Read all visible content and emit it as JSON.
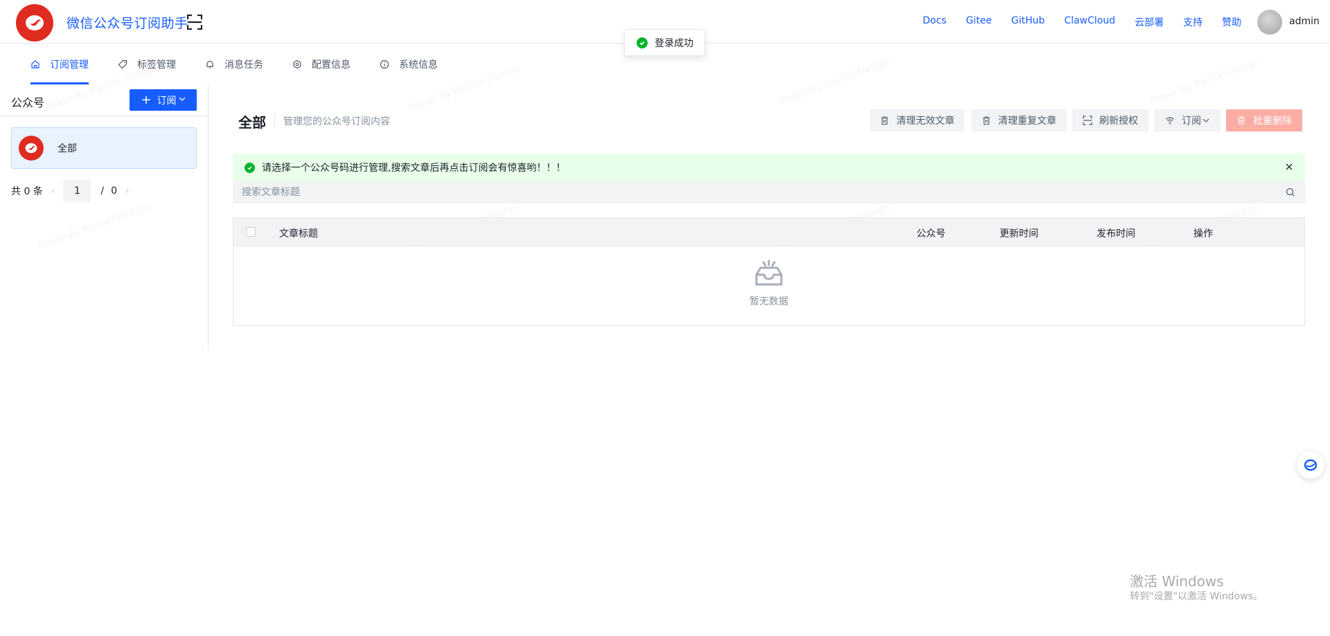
{
  "header": {
    "app_title": "微信公众号订阅助手",
    "links": [
      "Docs",
      "Gitee",
      "GitHub",
      "ClawCloud",
      "云部署",
      "支持",
      "赞助"
    ],
    "username": "admin"
  },
  "toast": {
    "message": "登录成功"
  },
  "tabs": [
    {
      "label": "订阅管理",
      "icon": "home-icon",
      "active": true
    },
    {
      "label": "标签管理",
      "icon": "tag-icon",
      "active": false
    },
    {
      "label": "消息任务",
      "icon": "bell-icon",
      "active": false
    },
    {
      "label": "配置信息",
      "icon": "gear-icon",
      "active": false
    },
    {
      "label": "系统信息",
      "icon": "info-icon",
      "active": false
    }
  ],
  "sidebar": {
    "title": "公众号",
    "subscribe_label": "订阅",
    "items": [
      {
        "label": "全部"
      }
    ],
    "pager": {
      "total_text": "共 0 条",
      "current": "1",
      "sep": "/",
      "pages": "0"
    }
  },
  "main": {
    "title": "全部",
    "subtitle": "管理您的公众号订阅内容",
    "actions": {
      "clean_invalid": "清理无效文章",
      "clean_duplicate": "清理重复文章",
      "refresh_auth": "刷新授权",
      "subscribe": "订阅",
      "batch_delete": "批量删除"
    },
    "alert": "请选择一个公众号码进行管理,搜索文章后再点击订阅会有惊喜哟！！！",
    "search_placeholder": "搜索文章标题",
    "table": {
      "columns": [
        "文章标题",
        "公众号",
        "更新时间",
        "发布时间",
        "操作"
      ],
      "empty_text": "暂无数据"
    }
  },
  "watermark": "Power By Rachel Design",
  "windows": {
    "line1": "激活 Windows",
    "line2": "转到\"设置\"以激活 Windows。"
  },
  "colors": {
    "primary": "#165dff",
    "brand_red": "#e02b20",
    "success": "#00b42a",
    "danger_light": "#fbaca3"
  }
}
